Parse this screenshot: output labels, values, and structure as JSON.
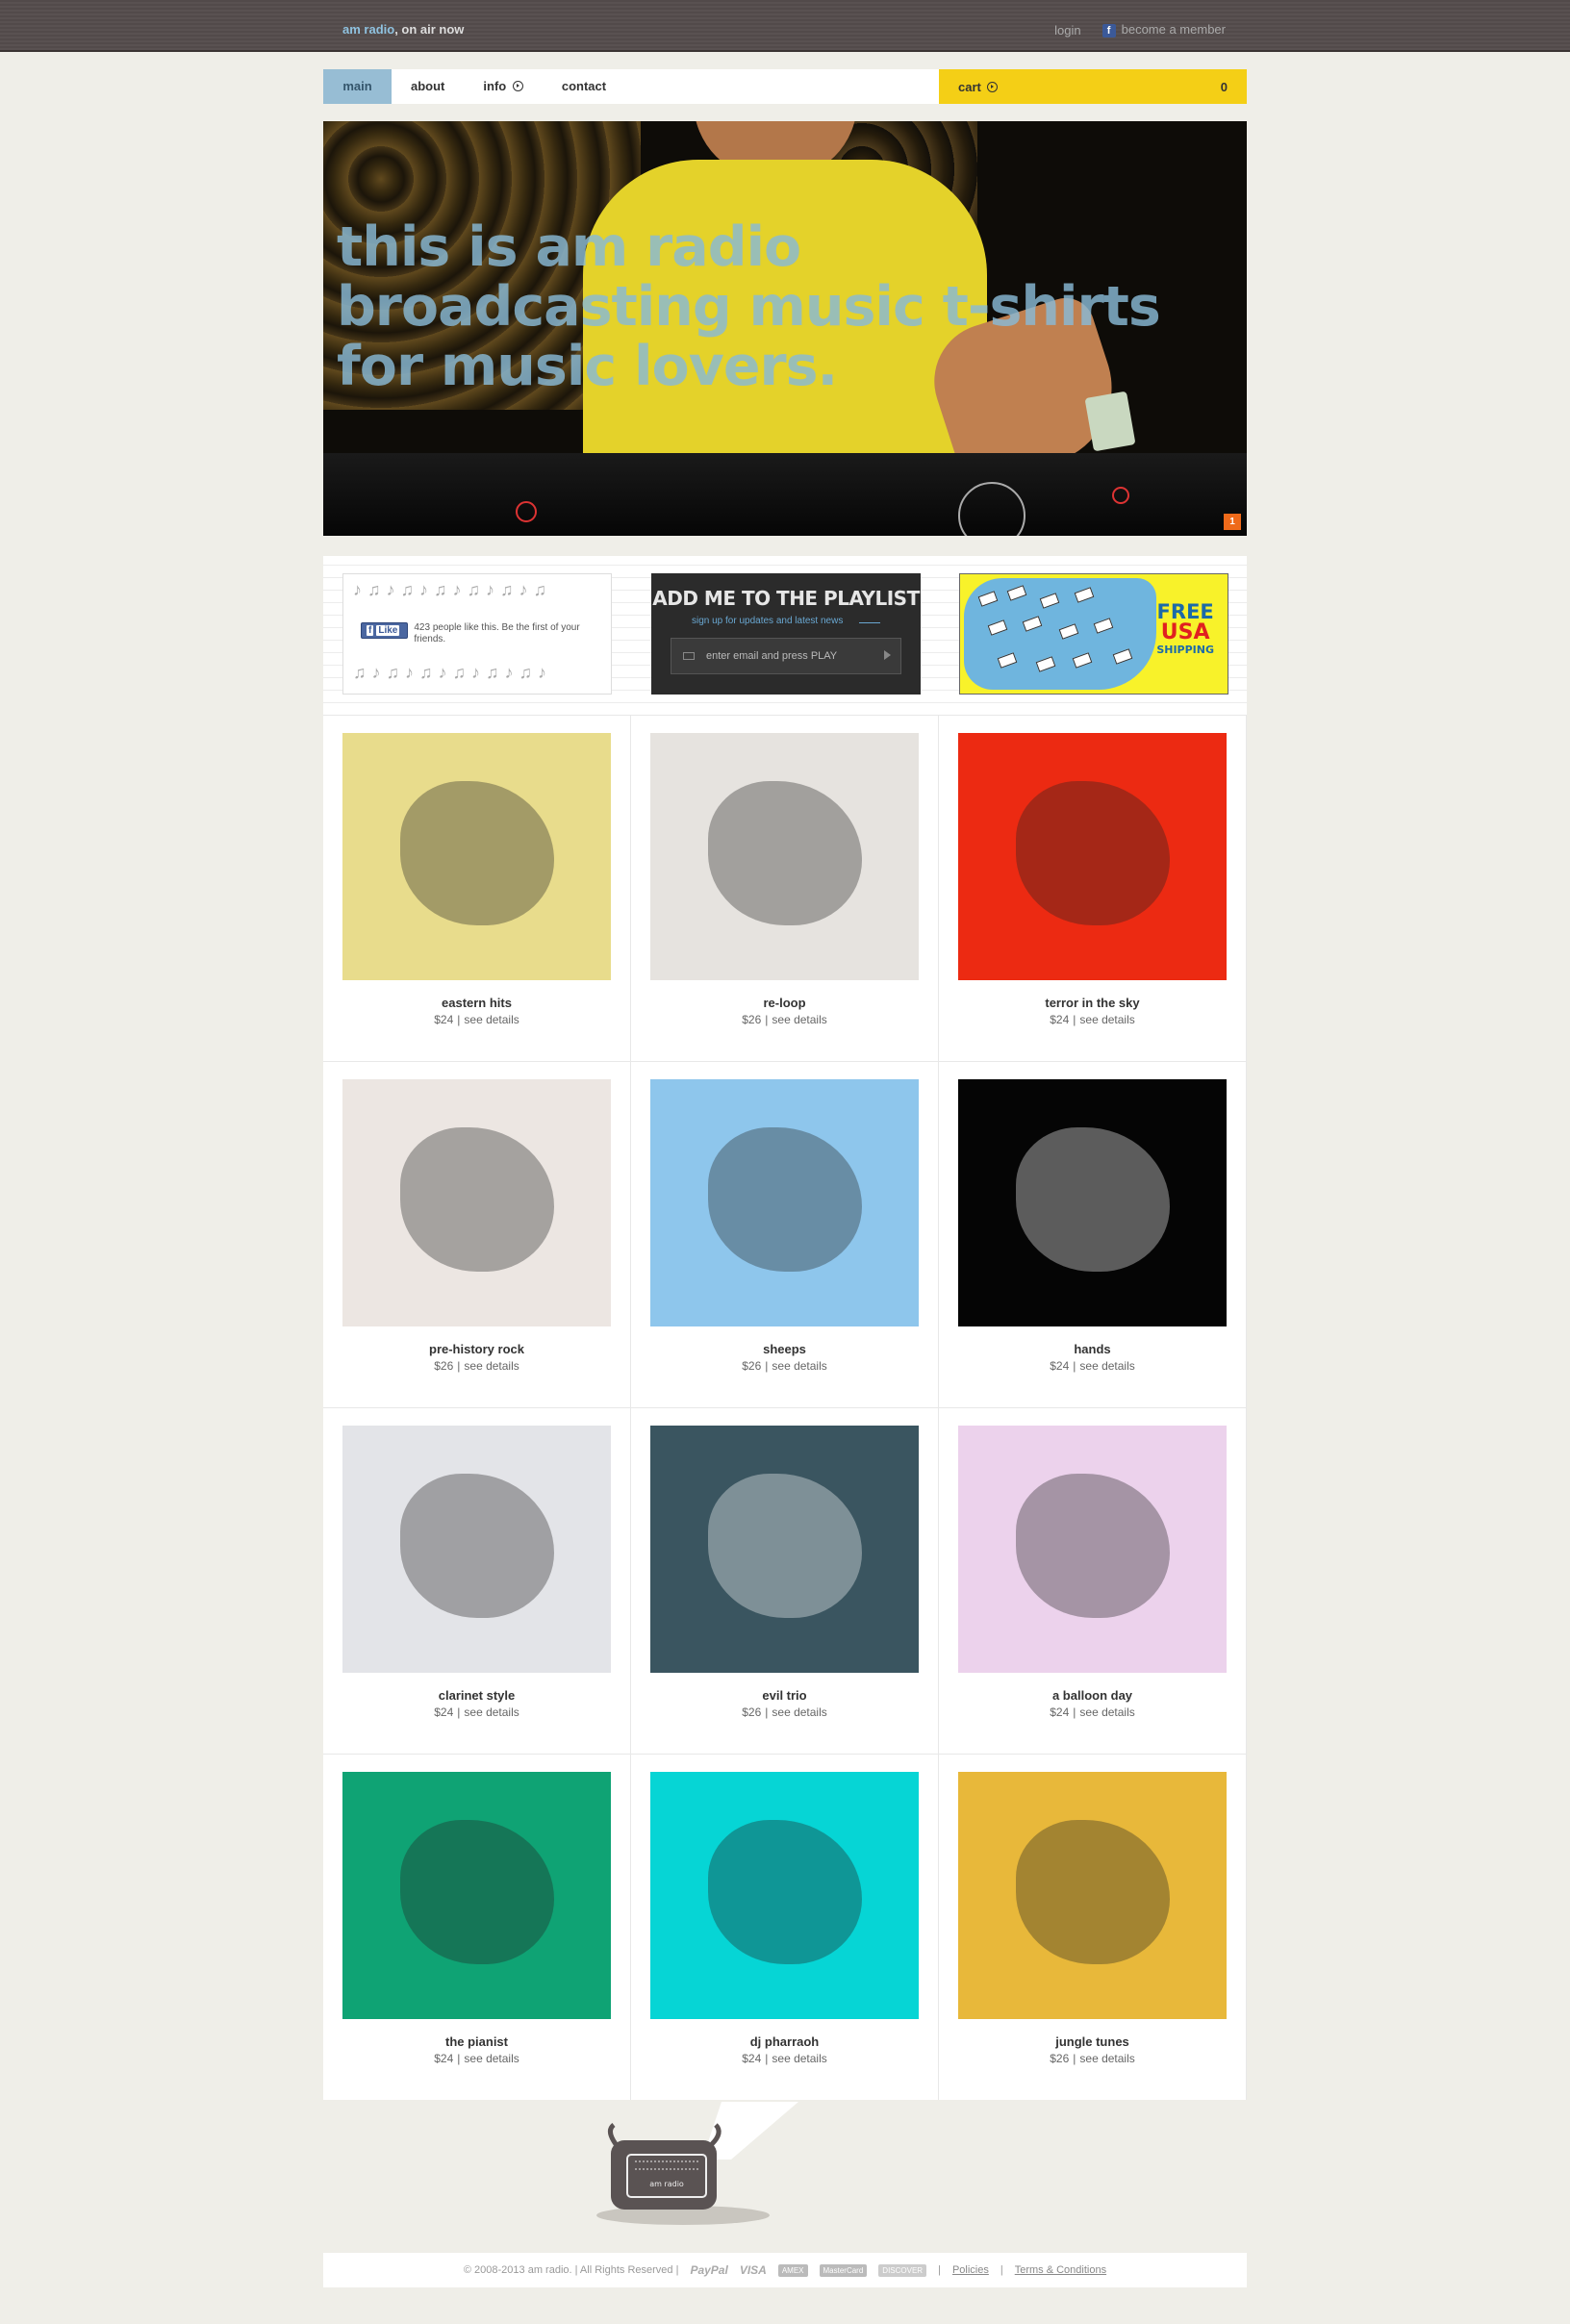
{
  "topbar": {
    "brand_name": "am radio",
    "brand_tagline": ", on air now",
    "login": "login",
    "member": "become a member"
  },
  "nav": {
    "items": [
      "main",
      "about",
      "info",
      "contact"
    ],
    "cart_label": "cart",
    "cart_count": "0"
  },
  "hero": {
    "headline_1": "this is am radio",
    "headline_2": "broadcasting music t-shirts",
    "headline_3": "for music lovers.",
    "slide_number": "1"
  },
  "promos": {
    "facebook": {
      "like_label": "Like",
      "like_text": "423 people like this. Be the first of your friends."
    },
    "playlist": {
      "title": "ADD ME TO THE PLAYLIST",
      "subtitle": "sign up for updates and latest news",
      "placeholder": "enter email and press PLAY"
    },
    "shipping": {
      "line1": "FREE",
      "line2": "USA",
      "line3": "SHIPPING"
    }
  },
  "products": [
    {
      "name": "eastern hits",
      "price": "$24",
      "link": "see details",
      "bg": "#e8dc8c"
    },
    {
      "name": "re-loop",
      "price": "$26",
      "link": "see details",
      "bg": "#e6e3df"
    },
    {
      "name": "terror in the sky",
      "price": "$24",
      "link": "see details",
      "bg": "#ec2a12"
    },
    {
      "name": "pre-history rock",
      "price": "$26",
      "link": "see details",
      "bg": "#ece6e2"
    },
    {
      "name": "sheeps",
      "price": "$26",
      "link": "see details",
      "bg": "#8ec6ec"
    },
    {
      "name": "hands",
      "price": "$24",
      "link": "see details",
      "bg": "#050505"
    },
    {
      "name": "clarinet style",
      "price": "$24",
      "link": "see details",
      "bg": "#e3e4e8"
    },
    {
      "name": "evil trio",
      "price": "$26",
      "link": "see details",
      "bg": "#3a5560"
    },
    {
      "name": "a balloon day",
      "price": "$24",
      "link": "see details",
      "bg": "#ecd2ec"
    },
    {
      "name": "the pianist",
      "price": "$24",
      "link": "see details",
      "bg": "#0fa374"
    },
    {
      "name": "dj pharraoh",
      "price": "$24",
      "link": "see details",
      "bg": "#06d5d5"
    },
    {
      "name": "jungle tunes",
      "price": "$26",
      "link": "see details",
      "bg": "#e8b83a"
    }
  ],
  "footer": {
    "copyright": "© 2008-2013 am radio. | All Rights Reserved |",
    "payments": [
      "PayPal",
      "VISA",
      "AMEX",
      "MasterCard",
      "DISCOVER"
    ],
    "policies": "Policies",
    "terms": "Terms & Conditions",
    "speaker_label": "am radio"
  }
}
